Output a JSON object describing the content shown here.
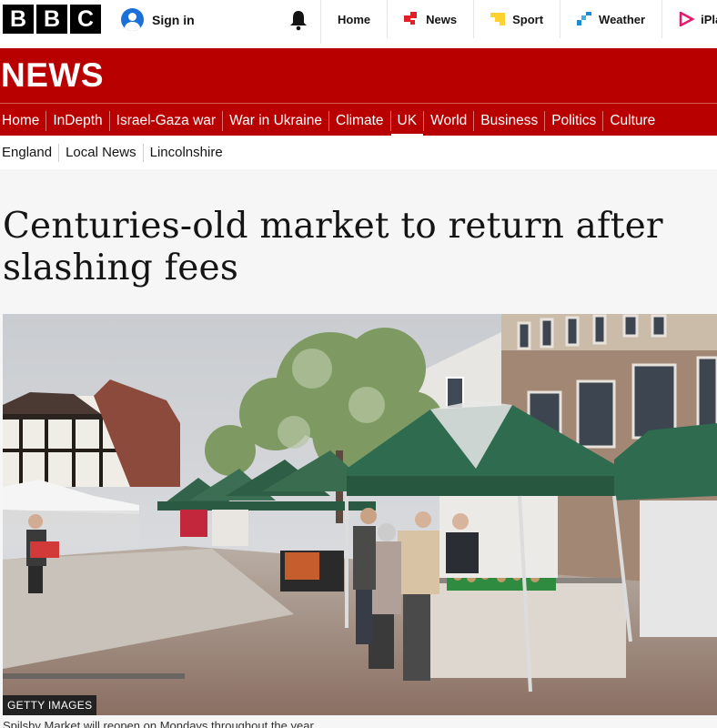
{
  "brand": {
    "letters": [
      "B",
      "B",
      "C"
    ]
  },
  "account": {
    "signin_label": "Sign in"
  },
  "topnav": [
    {
      "label": "Home",
      "icon": ""
    },
    {
      "label": "News",
      "icon": "news-icon",
      "color": "#e41e26"
    },
    {
      "label": "Sport",
      "icon": "sport-icon",
      "color": "#ffd230"
    },
    {
      "label": "Weather",
      "icon": "weather-icon",
      "color": "#1c8bd1"
    },
    {
      "label": "iPlayer",
      "icon": "iplayer-icon",
      "color": "#e8186d"
    }
  ],
  "section": {
    "title": "NEWS",
    "color": "#b80000"
  },
  "mainnav": [
    {
      "label": "Home"
    },
    {
      "label": "InDepth"
    },
    {
      "label": "Israel-Gaza war"
    },
    {
      "label": "War in Ukraine"
    },
    {
      "label": "Climate"
    },
    {
      "label": "UK",
      "active": true
    },
    {
      "label": "World"
    },
    {
      "label": "Business"
    },
    {
      "label": "Politics"
    },
    {
      "label": "Culture"
    }
  ],
  "subnav": [
    {
      "label": "England"
    },
    {
      "label": "Local News"
    },
    {
      "label": "Lincolnshire",
      "active": true
    }
  ],
  "article": {
    "headline": "Centuries-old market to return after slashing fees",
    "image_credit": "GETTY IMAGES",
    "caption": "Spilsby Market will reopen on Mondays throughout the year"
  }
}
